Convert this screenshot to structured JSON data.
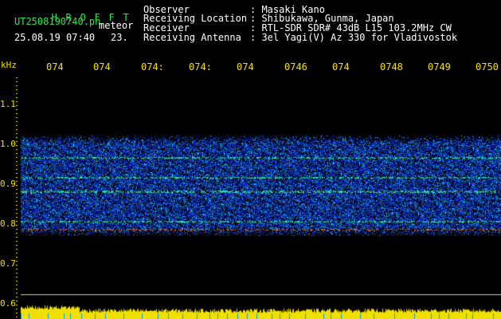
{
  "title_letters": [
    "H",
    "R",
    "O",
    "F",
    "F",
    "T"
  ],
  "file_name": "UT2508190740.pn",
  "kind": "meteor",
  "date_time": "25.08.19 07:40",
  "count": "23.",
  "header": {
    "rows": [
      {
        "label": "Observer",
        "value": ": Masaki Kano"
      },
      {
        "label": "Receiving Location",
        "value": ": Shibukawa, Gunma, Japan"
      },
      {
        "label": "Receiver",
        "value": ": RTL-SDR SDR# 43dB L15 103.2MHz CW"
      },
      {
        "label": "Receiving Antenna",
        "value": ": 3el Yagi(V) Az 330 for Vladivostok"
      }
    ]
  },
  "y_unit": "kHz",
  "y_labels": [
    "1.1",
    "1.0",
    "0.9",
    "0.8",
    "0.7",
    "0.6"
  ],
  "time_ticks": [
    "074",
    "074",
    "074:",
    "074:",
    "074",
    "0746",
    "074",
    "0748",
    "0749",
    "0750"
  ],
  "chart_data": {
    "type": "heatmap",
    "ylabel": "kHz",
    "ylim": [
      0.6,
      1.15
    ],
    "x_labels": [
      "074",
      "074",
      "074:",
      "074:",
      "074",
      "0746",
      "074",
      "0748",
      "0749",
      "0750"
    ],
    "bright_lines_khz": [
      0.965,
      0.915,
      0.88,
      0.805,
      0.785
    ],
    "noise_band_khz": [
      0.77,
      1.02
    ]
  },
  "colors": {
    "background": "#000000",
    "labels": "#f0e000",
    "title": "#2ee84a",
    "header": "#ffffff"
  }
}
